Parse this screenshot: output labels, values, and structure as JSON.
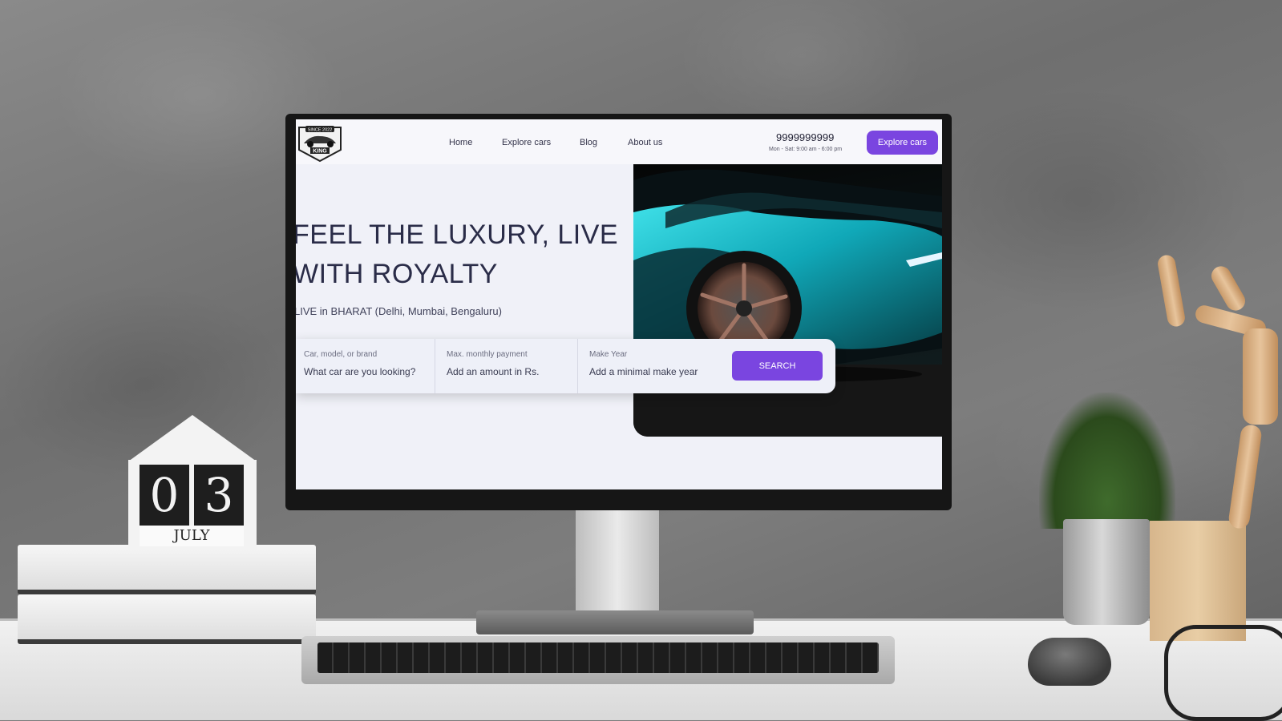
{
  "nav": {
    "logo_text_top": "SINCE 2022",
    "logo_text_bottom": "KING",
    "links": [
      "Home",
      "Explore cars",
      "Blog",
      "About us"
    ],
    "phone": "9999999999",
    "hours": "Mon - Sat: 9:00 am - 6:00 pm",
    "cta_label": "Explore cars"
  },
  "hero": {
    "title_line1": "FEEL THE LUXURY, LIVE",
    "title_line2": "WITH ROYALTY",
    "subtitle": "LIVE in BHARAT (Delhi, Mumbai, Bengaluru)"
  },
  "search": {
    "fields": [
      {
        "label": "Car, model, or brand",
        "placeholder": "What car are you looking?"
      },
      {
        "label": "Max. monthly payment",
        "placeholder": "Add an amount in Rs."
      },
      {
        "label": "Make Year",
        "placeholder": "Add a minimal make year"
      }
    ],
    "button_label": "SEARCH"
  },
  "calendar": {
    "day": [
      "0",
      "3"
    ],
    "month": "JULY"
  },
  "colors": {
    "accent": "#7a45e0",
    "page_bg": "#f0f1f8",
    "title": "#2a2c48"
  }
}
